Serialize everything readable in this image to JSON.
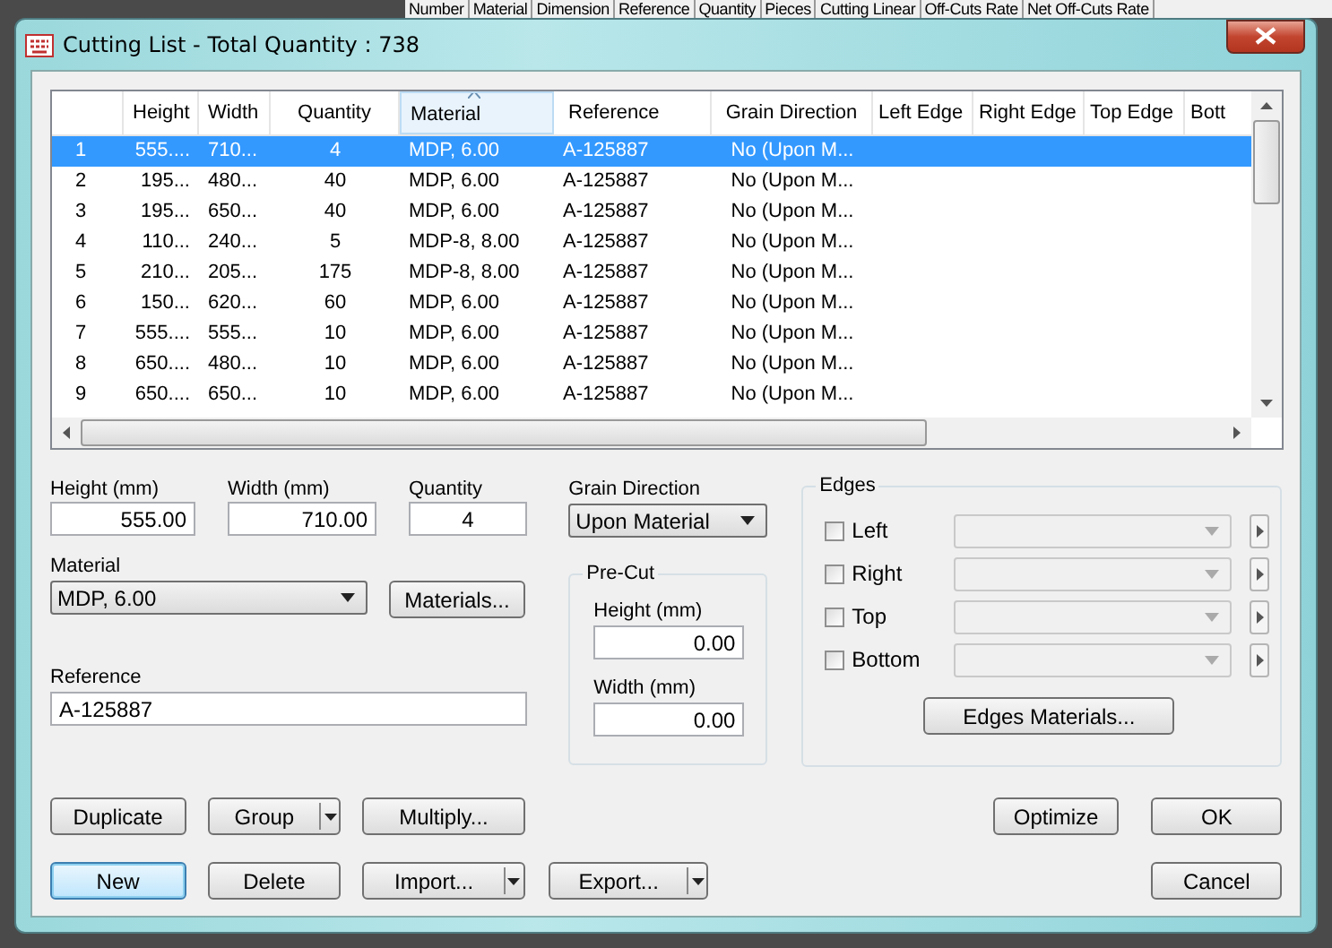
{
  "background_table": {
    "columns": [
      "Number",
      "Material",
      "Dimension",
      "Reference",
      "Quantity",
      "Pieces",
      "Cutting Linear",
      "Off-Cuts Rate",
      "Net Off-Cuts Rate"
    ]
  },
  "window": {
    "title": "Cutting List - Total Quantity : 738"
  },
  "table": {
    "columns": [
      {
        "sorted": false
      },
      {
        "label": "Height",
        "sorted": false
      },
      {
        "label": "Width",
        "sorted": false
      },
      {
        "label": "Quantity",
        "sorted": false
      },
      {
        "label": "Material",
        "sorted": true
      },
      {
        "label": "Reference",
        "sorted": false
      },
      {
        "label": "Grain Direction",
        "sorted": false
      },
      {
        "label": "Left Edge",
        "sorted": false
      },
      {
        "label": "Right Edge",
        "sorted": false
      },
      {
        "label": "Top Edge",
        "sorted": false
      },
      {
        "label": "Bott",
        "sorted": false
      }
    ],
    "rows": [
      {
        "selected": true,
        "cells": [
          "1",
          "555....",
          "710...",
          "4",
          "MDP, 6.00",
          "A-125887",
          "No (Upon M..."
        ]
      },
      {
        "selected": false,
        "cells": [
          "2",
          "195...",
          "480...",
          "40",
          "MDP, 6.00",
          "A-125887",
          "No (Upon M..."
        ]
      },
      {
        "selected": false,
        "cells": [
          "3",
          "195...",
          "650...",
          "40",
          "MDP, 6.00",
          "A-125887",
          "No (Upon M..."
        ]
      },
      {
        "selected": false,
        "cells": [
          "4",
          "110...",
          "240...",
          "5",
          "MDP-8, 8.00",
          "A-125887",
          "No (Upon M..."
        ]
      },
      {
        "selected": false,
        "cells": [
          "5",
          "210...",
          "205...",
          "175",
          "MDP-8, 8.00",
          "A-125887",
          "No (Upon M..."
        ]
      },
      {
        "selected": false,
        "cells": [
          "6",
          "150...",
          "620...",
          "60",
          "MDP, 6.00",
          "A-125887",
          "No (Upon M..."
        ]
      },
      {
        "selected": false,
        "cells": [
          "7",
          "555....",
          "555...",
          "10",
          "MDP, 6.00",
          "A-125887",
          "No (Upon M..."
        ]
      },
      {
        "selected": false,
        "cells": [
          "8",
          "650....",
          "480...",
          "10",
          "MDP, 6.00",
          "A-125887",
          "No (Upon M..."
        ]
      },
      {
        "selected": false,
        "cells": [
          "9",
          "650....",
          "650...",
          "10",
          "MDP, 6.00",
          "A-125887",
          "No (Upon M..."
        ]
      }
    ]
  },
  "form": {
    "height": {
      "label": "Height (mm)",
      "value": "555.00"
    },
    "width": {
      "label": "Width (mm)",
      "value": "710.00"
    },
    "quantity": {
      "label": "Quantity",
      "value": "4"
    },
    "grain_direction": {
      "label": "Grain Direction",
      "value": "Upon Material"
    },
    "material": {
      "label": "Material",
      "value": "MDP, 6.00"
    },
    "materials_button": "Materials...",
    "reference": {
      "label": "Reference",
      "value": "A-125887"
    },
    "pre_cut": {
      "title": "Pre-Cut",
      "height": {
        "label": "Height (mm)",
        "value": "0.00"
      },
      "width": {
        "label": "Width (mm)",
        "value": "0.00"
      }
    },
    "edges": {
      "title": "Edges",
      "items": [
        {
          "label": "Left",
          "checked": false
        },
        {
          "label": "Right",
          "checked": false
        },
        {
          "label": "Top",
          "checked": false
        },
        {
          "label": "Bottom",
          "checked": false
        }
      ],
      "button": "Edges Materials..."
    }
  },
  "buttons_row_1": [
    {
      "label": "Duplicate",
      "kind": "plain"
    },
    {
      "label": "Group",
      "kind": "split"
    },
    {
      "label": "Multiply...",
      "kind": "plain"
    },
    {
      "label": "Optimize",
      "kind": "plain"
    },
    {
      "label": "OK",
      "kind": "plain"
    }
  ],
  "buttons_row_2": [
    {
      "label": "New",
      "kind": "default"
    },
    {
      "label": "Delete",
      "kind": "plain"
    },
    {
      "label": "Import...",
      "kind": "split"
    },
    {
      "label": "Export...",
      "kind": "split"
    },
    {
      "label": "Cancel",
      "kind": "plain"
    }
  ]
}
